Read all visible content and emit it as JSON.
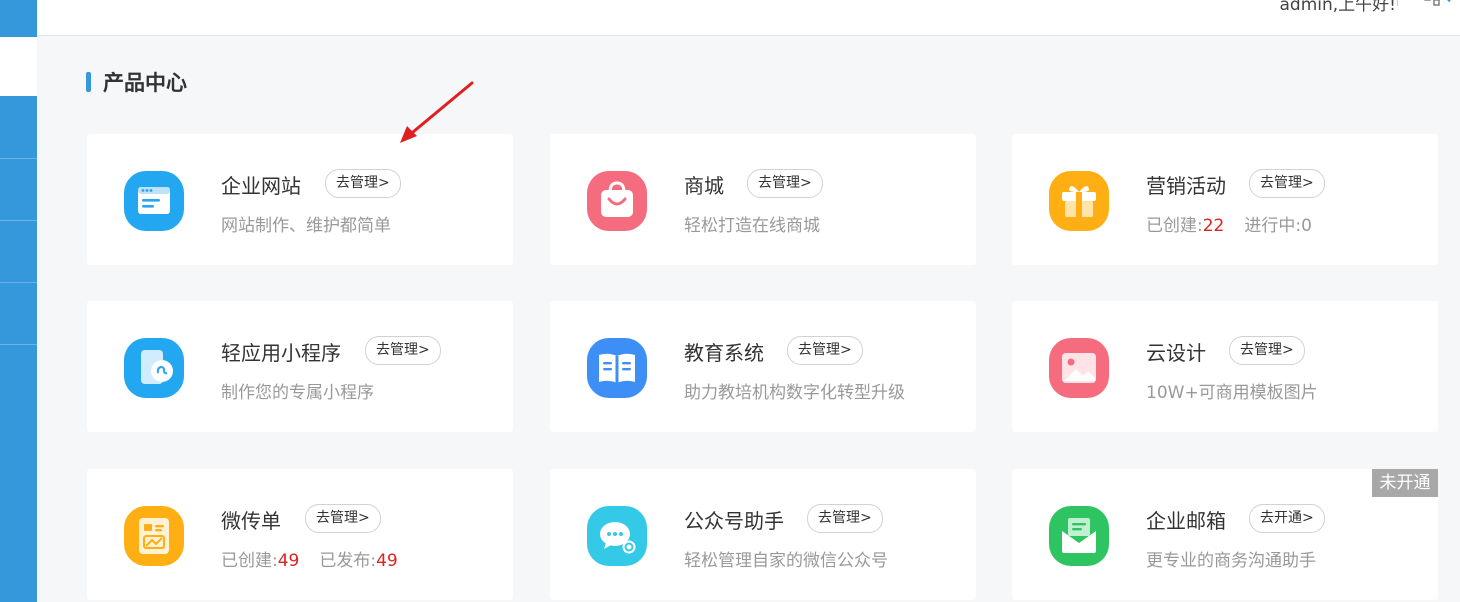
{
  "header": {
    "greeting": "admin,上午好!"
  },
  "section": {
    "title": "产品中心"
  },
  "colors": {
    "accent": "#3498db",
    "highlight": "#e02020"
  },
  "products": [
    {
      "title": "企业网站",
      "button": "去管理>",
      "desc": "网站制作、维护都简单",
      "icon": "website-icon"
    },
    {
      "title": "商城",
      "button": "去管理>",
      "desc": "轻松打造在线商城",
      "icon": "shopping-bag-icon"
    },
    {
      "title": "营销活动",
      "button": "去管理>",
      "icon": "gift-icon",
      "stats": {
        "label1": "已创建:",
        "value1": "22",
        "label2": "进行中:",
        "value2": "0"
      }
    },
    {
      "title": "轻应用小程序",
      "button": "去管理>",
      "desc": "制作您的专属小程序",
      "icon": "mini-program-icon"
    },
    {
      "title": "教育系统",
      "button": "去管理>",
      "desc": "助力教培机构数字化转型升级",
      "icon": "book-icon"
    },
    {
      "title": "云设计",
      "button": "去管理>",
      "desc": "10W+可商用模板图片",
      "icon": "image-icon"
    },
    {
      "title": "微传单",
      "button": "去管理>",
      "icon": "flyer-icon",
      "stats": {
        "label1": "已创建:",
        "value1": "49",
        "label2": "已发布:",
        "value2": "49"
      }
    },
    {
      "title": "公众号助手",
      "button": "去管理>",
      "desc": "轻松管理自家的微信公众号",
      "icon": "wechat-icon"
    },
    {
      "title": "企业邮箱",
      "button": "去开通>",
      "desc": "更专业的商务沟通助手",
      "icon": "mail-icon",
      "badge": "未开通"
    }
  ]
}
